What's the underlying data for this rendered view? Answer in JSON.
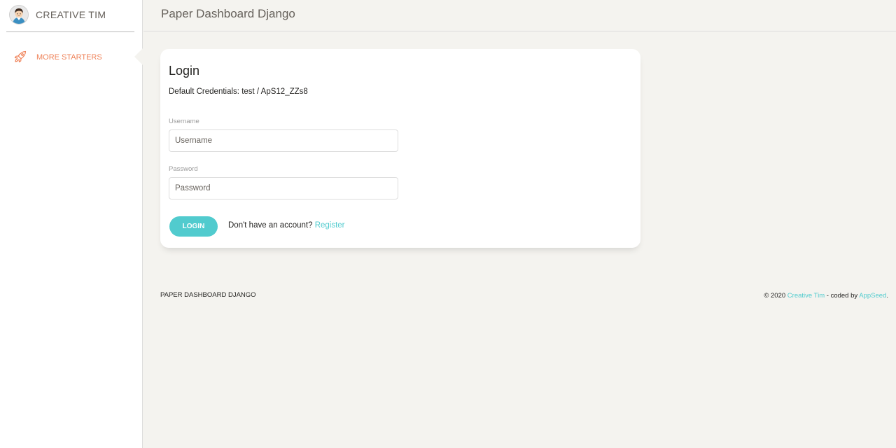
{
  "sidebar": {
    "logo_text": "CREATIVE TIM",
    "items": [
      {
        "label": "MORE STARTERS",
        "icon": "rocket-icon"
      }
    ]
  },
  "navbar": {
    "brand": "Paper Dashboard Django"
  },
  "login_card": {
    "title": "Login",
    "subtitle": "Default Credentials: test / ApS12_ZZs8",
    "username_label": "Username",
    "username_placeholder": "Username",
    "username_value": "",
    "password_label": "Password",
    "password_placeholder": "Password",
    "password_value": "",
    "login_button": "LOGIN",
    "register_prompt": "Don't have an account?",
    "register_link": "Register"
  },
  "footer": {
    "left": "PAPER DASHBOARD DJANGO",
    "copyright": "© 2020",
    "creative_tim_link": "Creative Tim",
    "coded_by": "- coded by",
    "appseed_link": "AppSeed",
    "period": "."
  },
  "colors": {
    "accent": "#51cbce",
    "sidebar_active": "#ef8157",
    "background": "#f4f3ef"
  }
}
